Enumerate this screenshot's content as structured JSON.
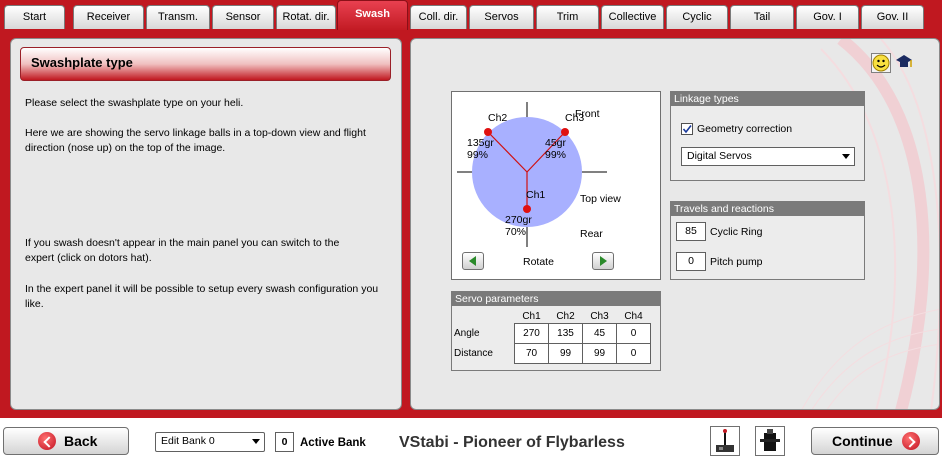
{
  "tabs": [
    {
      "label": "Start"
    },
    {
      "label": "Receiver"
    },
    {
      "label": "Transm."
    },
    {
      "label": "Sensor"
    },
    {
      "label": "Rotat. dir."
    },
    {
      "label": "Swash"
    },
    {
      "label": "Coll. dir."
    },
    {
      "label": "Servos"
    },
    {
      "label": "Trim"
    },
    {
      "label": "Collective"
    },
    {
      "label": "Cyclic"
    },
    {
      "label": "Tail"
    },
    {
      "label": "Gov. I"
    },
    {
      "label": "Gov. II"
    }
  ],
  "active_tab": "Swash",
  "colors": {
    "accent": "#c01820",
    "swash_disc": "#a8b0ff",
    "ball": "#e01010"
  },
  "left": {
    "title": "Swashplate type",
    "p1": "Please select the swashplate type on your heli.",
    "p2": "Here we are showing the servo linkage balls in a top-down view and flight direction (nose up) on the top of the image.",
    "p3": "If you swash doesn't appear in the main panel you can switch to the expert (click on dotors hat).",
    "p4": "In the expert panel it will be possible to setup every swash configuration you like."
  },
  "diagram": {
    "front": "Front",
    "top_view": "Top view",
    "rear": "Rear",
    "rotate": "Rotate",
    "ch1": {
      "name": "Ch1",
      "angle": "270gr",
      "dist": "70%"
    },
    "ch2": {
      "name": "Ch2",
      "angle": "135gr",
      "dist": "99%"
    },
    "ch3": {
      "name": "Ch3",
      "angle": "45gr",
      "dist": "99%"
    }
  },
  "servo_params": {
    "title": "Servo parameters",
    "headers": [
      "Ch1",
      "Ch2",
      "Ch3",
      "Ch4"
    ],
    "angle_label": "Angle",
    "distance_label": "Distance",
    "angle": [
      "270",
      "135",
      "45",
      "0"
    ],
    "distance": [
      "70",
      "99",
      "99",
      "0"
    ]
  },
  "linkage": {
    "title": "Linkage types",
    "geometry_label": "Geometry correction",
    "geometry_checked": true,
    "servo_type": "Digital Servos"
  },
  "travels": {
    "title": "Travels and reactions",
    "cyclic_ring_value": "85",
    "cyclic_ring_label": "Cyclic Ring",
    "pitch_pump_value": "0",
    "pitch_pump_label": "Pitch pump"
  },
  "bottom": {
    "back": "Back",
    "bank_select": "Edit Bank 0",
    "active_bank_value": "0",
    "active_bank_label": "Active Bank",
    "app_title": "VStabi - Pioneer of Flybarless",
    "continue": "Continue"
  },
  "icons": {
    "smiley": "smiley-icon",
    "hat": "doctor-hat-icon",
    "transmitter": "transmitter-icon",
    "servo": "servo-icon"
  }
}
